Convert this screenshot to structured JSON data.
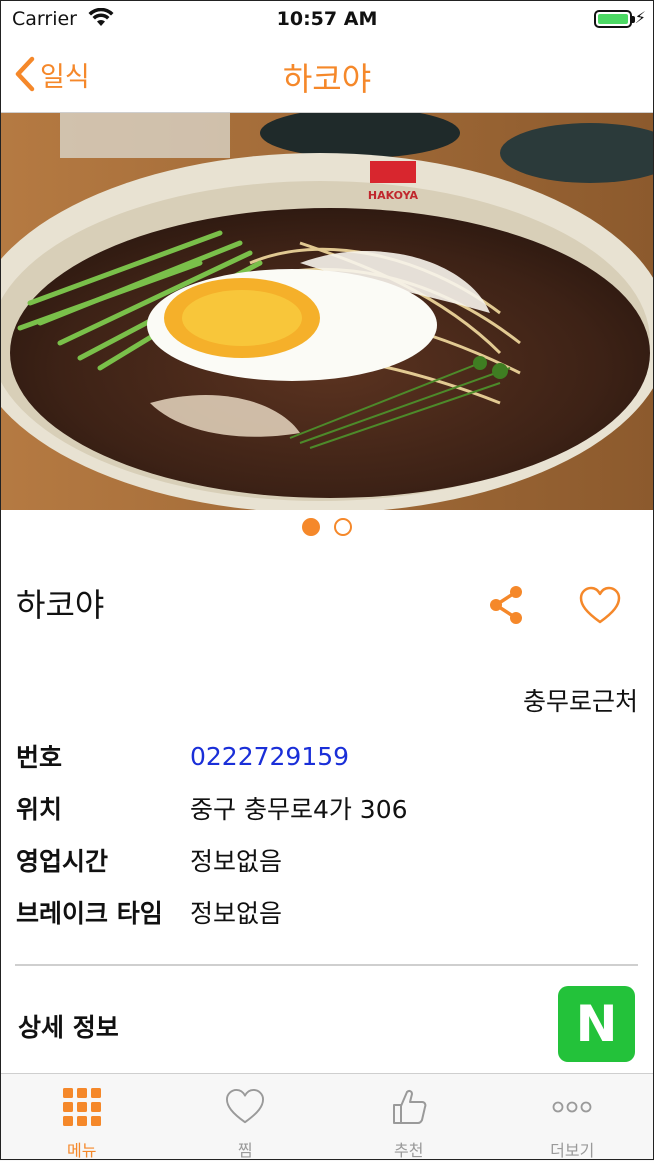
{
  "status_bar": {
    "carrier": "Carrier",
    "time": "10:57 AM",
    "battery_level": 1.0
  },
  "nav": {
    "back_label": "일식",
    "title": "하코야"
  },
  "gallery": {
    "page_count": 2,
    "current_page": 1
  },
  "restaurant": {
    "name": "하코야",
    "area": "충무로근처",
    "info": [
      {
        "label": "번호",
        "value": "0222729159",
        "is_link": true
      },
      {
        "label": "위치",
        "value": "중구 충무로4가 306",
        "is_link": false
      },
      {
        "label": "영업시간",
        "value": "정보없음",
        "is_link": false
      },
      {
        "label": "브레이크 타임",
        "value": "정보없음",
        "is_link": false
      }
    ],
    "detail_label": "상세 정보",
    "naver_letter": "N"
  },
  "tabs": [
    {
      "label": "메뉴",
      "icon": "grid-icon",
      "active": true
    },
    {
      "label": "찜",
      "icon": "heart-icon",
      "active": false
    },
    {
      "label": "추천",
      "icon": "thumbs-up-icon",
      "active": false
    },
    {
      "label": "더보기",
      "icon": "more-icon",
      "active": false
    }
  ],
  "colors": {
    "accent": "#f5882a",
    "link": "#1a2fd8",
    "naver": "#23c23a",
    "battery": "#4cd964"
  }
}
